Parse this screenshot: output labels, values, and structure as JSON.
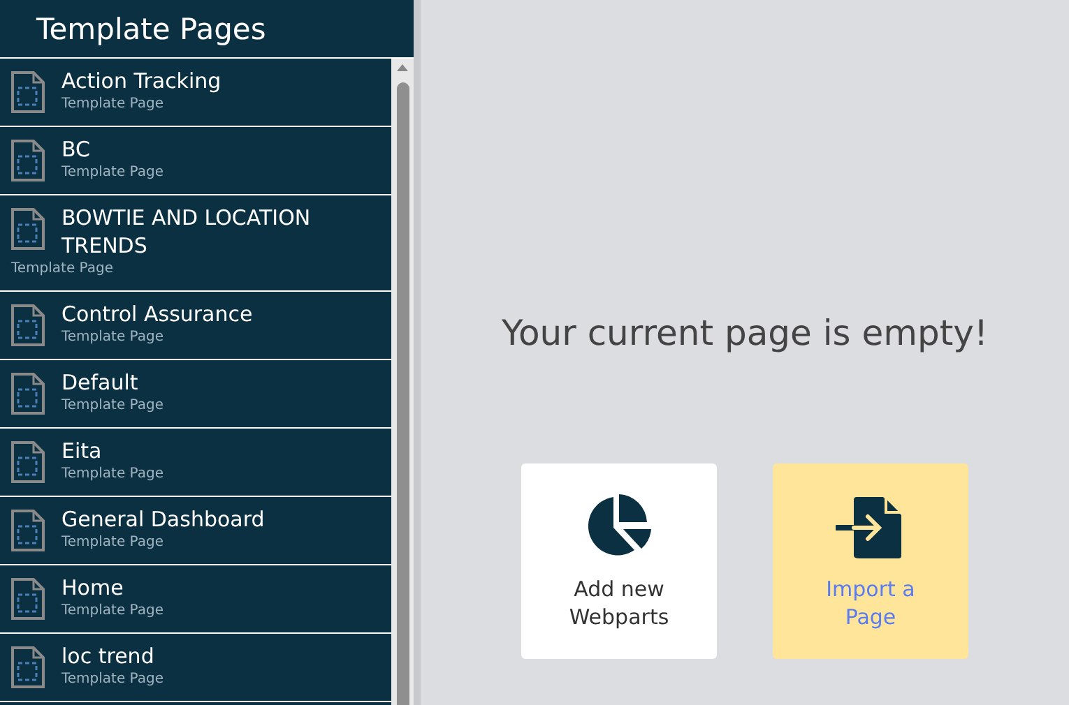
{
  "sidebar": {
    "title": "Template Pages",
    "items": [
      {
        "title": "Action Tracking",
        "subtitle": "Template Page"
      },
      {
        "title": "BC",
        "subtitle": "Template Page"
      },
      {
        "title": "BOWTIE AND LOCATION TRENDS",
        "subtitle": "Template Page"
      },
      {
        "title": "Control Assurance",
        "subtitle": "Template Page"
      },
      {
        "title": "Default",
        "subtitle": "Template Page"
      },
      {
        "title": "Eita",
        "subtitle": "Template Page"
      },
      {
        "title": "General Dashboard",
        "subtitle": "Template Page"
      },
      {
        "title": "Home",
        "subtitle": "Template Page"
      },
      {
        "title": "loc trend",
        "subtitle": "Template Page"
      }
    ]
  },
  "main": {
    "heading": "Your current page is empty!",
    "actions": [
      {
        "kind": "webparts",
        "label": "Add new Webparts"
      },
      {
        "kind": "import",
        "label": "Import a Page"
      }
    ]
  }
}
